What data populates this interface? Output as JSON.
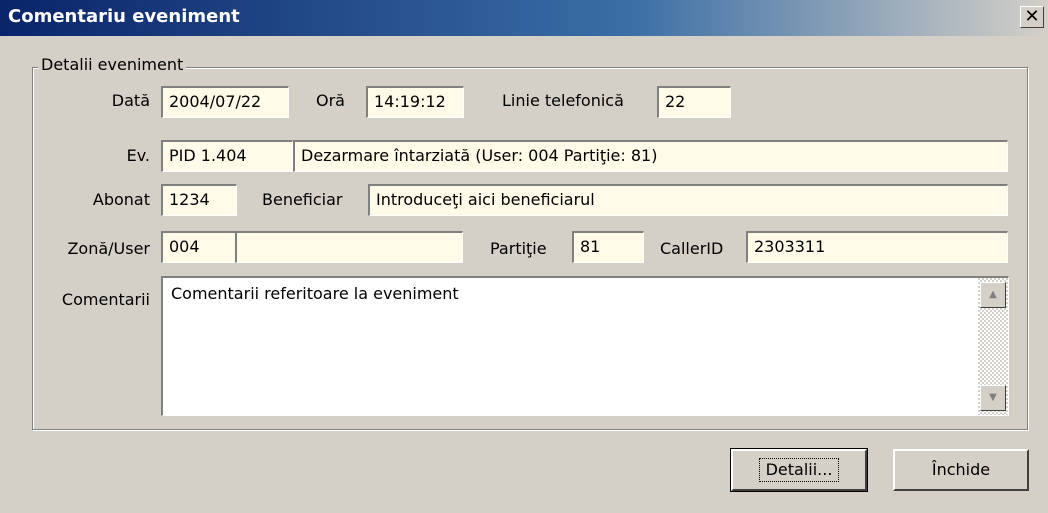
{
  "window": {
    "title": "Comentariu eveniment",
    "close_glyph": "✕"
  },
  "group": {
    "legend": "Detalii eveniment"
  },
  "labels": {
    "data": "Dată",
    "ora": "Oră",
    "linie": "Linie telefonică",
    "ev": "Ev.",
    "abonat": "Abonat",
    "beneficiar": "Beneficiar",
    "zona": "Zonă/User",
    "partitie": "Partiţie",
    "callerid": "CallerID",
    "comentarii": "Comentarii"
  },
  "fields": {
    "data": "2004/07/22",
    "ora": "14:19:12",
    "linie": "22",
    "ev_code": "PID 1.404",
    "ev_desc": "Dezarmare întarziată (User: 004 Partiţie: 81)",
    "abonat": "1234",
    "beneficiar": "Introduceţi aici beneficiarul",
    "zona_code": "004",
    "zona_name": "",
    "partitie": "81",
    "callerid": "2303311",
    "comentarii": "Comentarii referitoare la eveniment"
  },
  "scrollbar": {
    "up_icon": "▲",
    "down_icon": "▼"
  },
  "buttons": {
    "detalii": "Detalii...",
    "inchide": "Închide"
  }
}
